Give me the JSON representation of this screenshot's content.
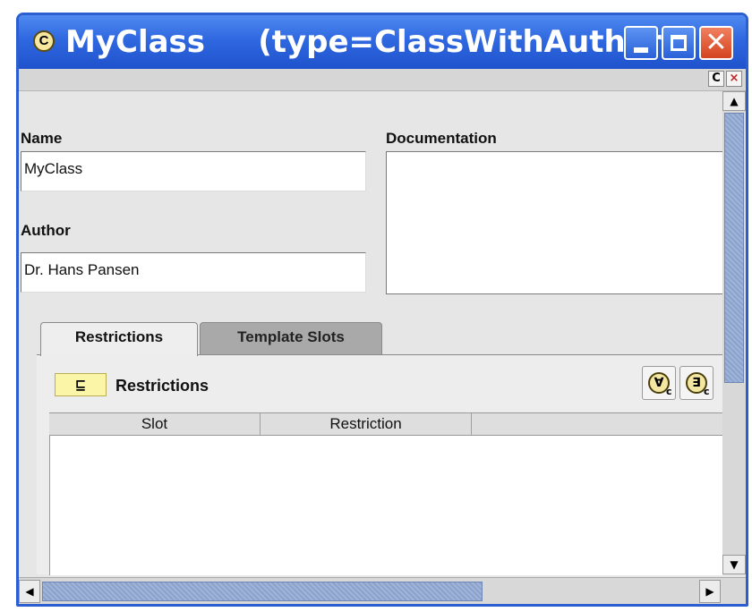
{
  "window": {
    "title_icon": "C",
    "title": "MyClass     (type=ClassWithAuthor)",
    "buttons": {
      "minimize": "minimize-icon",
      "maximize": "maximize-icon",
      "close": "✕"
    }
  },
  "subbar": {
    "c_button": "C",
    "x_button": "×"
  },
  "form": {
    "name_label": "Name",
    "name_value": "MyClass",
    "documentation_label": "Documentation",
    "documentation_value": "",
    "author_label": "Author",
    "author_value": "Dr. Hans Pansen"
  },
  "tabs": [
    {
      "label": "Restrictions",
      "active": true
    },
    {
      "label": "Template Slots",
      "active": false
    }
  ],
  "restrictions": {
    "icon": "⊑",
    "title": "Restrictions",
    "tools": [
      {
        "icon": "∀",
        "sub": "c"
      },
      {
        "icon": "∃",
        "sub": "c"
      }
    ],
    "columns": [
      "Slot",
      "Restriction",
      ""
    ],
    "rows": []
  },
  "scrollbars": {
    "up": "▲",
    "down": "▼",
    "left": "◀",
    "right": "▶"
  }
}
